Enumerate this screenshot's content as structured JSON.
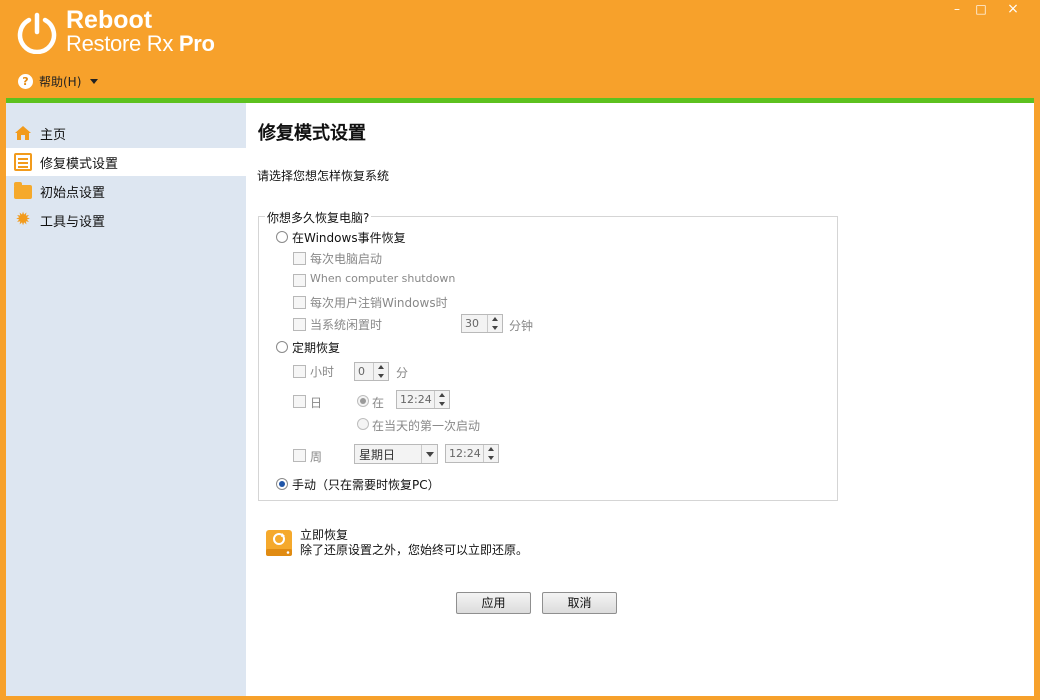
{
  "app": {
    "brand_line1": "Reboot",
    "brand_line2": "Restore Rx",
    "brand_pro": "Pro",
    "accent_color": "#f7a12b",
    "bar_color": "#5dc11f",
    "window_buttons": {
      "minimize": "–",
      "maximize": "□",
      "close": "×"
    }
  },
  "menu": {
    "help_icon": "help-circle-icon",
    "help_label": "帮助(H)"
  },
  "sidebar": {
    "items": [
      {
        "label": "主页",
        "icon": "home-icon",
        "active": false
      },
      {
        "label": "修复模式设置",
        "icon": "list-icon",
        "active": true
      },
      {
        "label": "初始点设置",
        "icon": "folder-icon",
        "active": false
      },
      {
        "label": "工具与设置",
        "icon": "gear-icon",
        "active": false
      }
    ]
  },
  "main": {
    "title": "修复模式设置",
    "subtitle": "请选择您想怎样恢复系统",
    "group_label": "你想多久恢复电脑?",
    "opt_windows_event": "在Windows事件恢复",
    "chk_each_boot": "每次电脑启动",
    "chk_shutdown": "When computer shutdown",
    "chk_logoff": "每次用户注销Windows时",
    "chk_idle": "当系统闲置时",
    "idle_value": "30",
    "idle_unit": "分钟",
    "opt_periodic": "定期恢复",
    "chk_hour": "小时",
    "hour_value": "0",
    "hour_unit": "分",
    "chk_day": "日",
    "day_at_label": "在",
    "day_time": "12:24",
    "day_first_boot": "在当天的第一次启动",
    "chk_week": "周",
    "week_day": "星期日",
    "week_time": "12:24",
    "opt_manual": "手动（只在需要时恢复PC）",
    "restore_now_title": "立即恢复",
    "restore_now_desc": "除了还原设置之外，您始终可以立即还原。",
    "apply_label": "应用",
    "cancel_label": "取消"
  }
}
